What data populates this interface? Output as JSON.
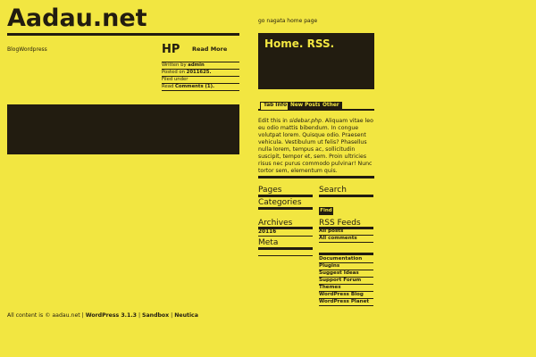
{
  "site": {
    "title": "Aadau.net",
    "description": "BlogWordpress",
    "home_link": "go nagata home page"
  },
  "post": {
    "title": "HP",
    "read_more": "Read More",
    "meta": [
      {
        "label": "Written by ",
        "value": "admin"
      },
      {
        "label": "Posted on ",
        "value": "2011625."
      },
      {
        "label": "Filed under",
        "value": ""
      },
      {
        "label": "Read ",
        "value": "Comments (1)."
      }
    ]
  },
  "header_box": {
    "text": "Home. RSS."
  },
  "tabs": {
    "items": [
      "Tab Info",
      "New Posts",
      "Other"
    ],
    "content_prefix": "Edit this in ",
    "content_file": "sidebar.php",
    "content_body": ". Aliquam vitae leo eu odio mattis bibendum. In congue volutpat lorem. Quisque odio. Praesent vehicula. Vestibulum ut felis? Phasellus nulla lorem, tempus ac, sollicitudin suscipit, tempor et, sem. Proin ultricies risus nec purus commodo pulvinar! Nunc tortor sem, elementum quis."
  },
  "left_widgets": {
    "pages": "Pages",
    "categories": "Categories",
    "archives": "Archives",
    "archives_item": "20116",
    "meta": "Meta"
  },
  "right_widgets": {
    "search": "Search",
    "find": "Find",
    "rss": "RSS Feeds",
    "rss_items": [
      "All posts",
      "All comments"
    ],
    "links": [
      "Documentation",
      "Plugins",
      "Suggest Ideas",
      "Support Forum",
      "Themes",
      "WordPress Blog",
      "WordPress Planet"
    ]
  },
  "footer": {
    "prefix": "All content is © aadau.net | ",
    "wp": "WordPress 3.1.3",
    "sep1": " | ",
    "sandbox": "Sandbox",
    "sep2": " | ",
    "neutica": "Neutica"
  },
  "colors": {
    "background": "#f2e641",
    "dark": "#221c10"
  }
}
